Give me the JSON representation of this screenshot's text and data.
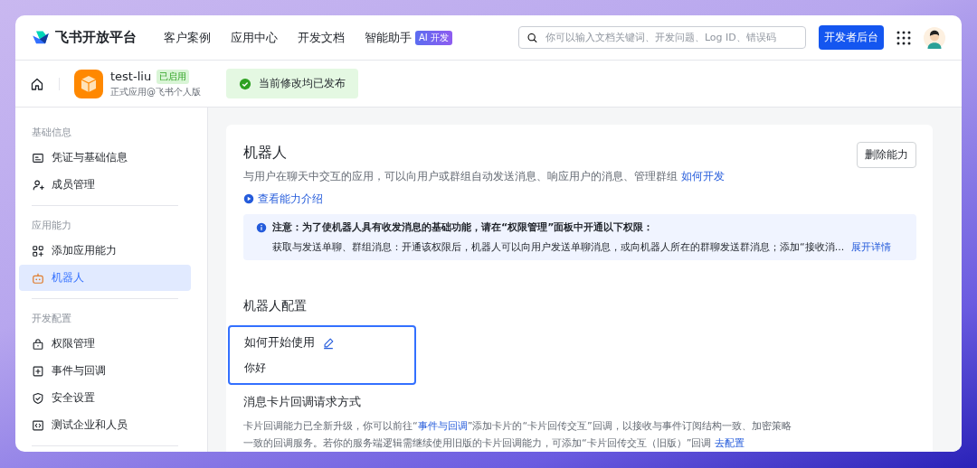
{
  "header": {
    "logo": "飞书开放平台",
    "nav": [
      {
        "label": "客户案例"
      },
      {
        "label": "应用中心"
      },
      {
        "label": "开发文档"
      },
      {
        "label": "智能助手",
        "badge": "AI 开发"
      }
    ],
    "search": {
      "placeholder": "你可以输入文档关键词、开发问题、Log ID、错误码"
    },
    "console_button": "开发者后台"
  },
  "app_bar": {
    "app_name": "test-liu",
    "status": "已启用",
    "subtitle": "正式应用@飞书个人版",
    "notice": "当前修改均已发布"
  },
  "sidebar": {
    "groups": [
      {
        "title": "基础信息",
        "items": [
          {
            "label": "凭证与基础信息",
            "selected": false
          },
          {
            "label": "成员管理",
            "selected": false
          }
        ]
      },
      {
        "title": "应用能力",
        "items": [
          {
            "label": "添加应用能力",
            "selected": false
          },
          {
            "label": "机器人",
            "selected": true
          }
        ]
      },
      {
        "title": "开发配置",
        "items": [
          {
            "label": "权限管理",
            "selected": false
          },
          {
            "label": "事件与回调",
            "selected": false
          },
          {
            "label": "安全设置",
            "selected": false
          },
          {
            "label": "测试企业和人员",
            "selected": false
          }
        ]
      }
    ]
  },
  "card": {
    "title": "机器人",
    "delete_button": "删除能力",
    "description": "与用户在聊天中交互的应用，可以向用户或群组自动发送消息、响应用户的消息、管理群组",
    "description_link": "如何开发",
    "intro_link": "查看能力介绍",
    "alert": {
      "title": "注意：为了使机器人具有收发消息的基础功能，请在“权限管理”面板中开通以下权限：",
      "body": "获取与发送单聊、群组消息：开通该权限后，机器人可以向用户发送单聊消息，或向机器人所在的群聊发送群消息；添加“接收消...",
      "link": "展开详情"
    },
    "config_title": "机器人配置",
    "start": {
      "title": "如何开始使用",
      "value": "你好",
      "highlighted": true
    },
    "callback": {
      "title": "消息卡片回调请求方式",
      "parts": [
        {
          "kind": "text",
          "text": "卡片回调能力已全新升级，你可以前往“"
        },
        {
          "kind": "link",
          "text": "事件与回调"
        },
        {
          "kind": "text",
          "text": "”添加卡片的“卡片回传交互”回调，以接收与事件订阅结构一致、加密策略一致的回调服务。若你的服务端逻辑需继续使用旧版的卡片回调能力，可添加“卡片回传交互（旧版）”回调 "
        },
        {
          "kind": "link",
          "text": "去配置"
        }
      ]
    }
  }
}
